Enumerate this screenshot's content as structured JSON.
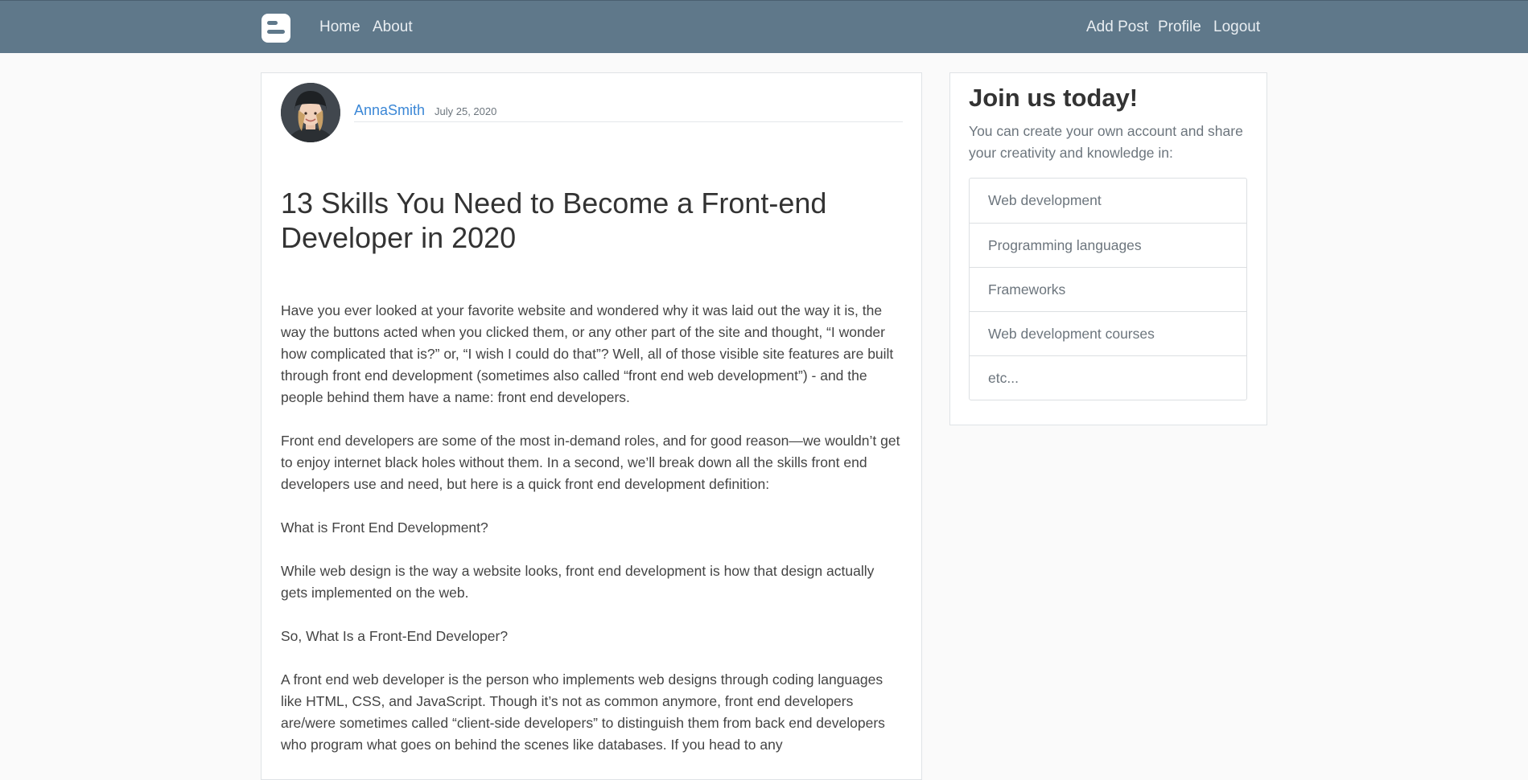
{
  "navbar": {
    "logo_icon": "blogger-logo-icon",
    "links_left": [
      {
        "label": "Home"
      },
      {
        "label": "About"
      }
    ],
    "links_right": [
      {
        "label": "Add Post"
      },
      {
        "label": "Profile"
      },
      {
        "label": "Logout"
      }
    ]
  },
  "post": {
    "author": "AnnaSmith",
    "date": "July 25, 2020",
    "avatar_icon": "author-avatar",
    "title": "13 Skills You Need to Become a Front-end Developer in 2020",
    "paragraphs": [
      "Have you ever looked at your favorite website and wondered why it was laid out the way it is, the way the buttons acted when you clicked them, or any other part of the site and thought, “I wonder how complicated that is?” or, “I wish I could do that”? Well, all of those visible site features are built through front end development (sometimes also called “front end web development”) - and the people behind them have a name: front end developers.",
      "Front end developers are some of the most in-demand roles, and for good reason—we wouldn’t get to enjoy internet black holes without them. In a second, we’ll break down all the skills front end developers use and need, but here is a quick front end development definition:",
      "What is Front End Development?",
      "While web design is the way a website looks, front end development is how that design actually gets implemented on the web.",
      "So, What Is a Front-End Developer?",
      "A front end web developer is the person who implements web designs through coding languages like HTML, CSS, and JavaScript. Though it’s not as common anymore, front end developers are/were sometimes called “client-side developers” to distinguish them from back end developers who program what goes on behind the scenes like databases. If you head to any"
    ]
  },
  "sidebar": {
    "title": "Join us today!",
    "text": "You can create your own account and share your creativity and knowledge in:",
    "items": [
      {
        "label": "Web development"
      },
      {
        "label": "Programming languages"
      },
      {
        "label": "Frameworks"
      },
      {
        "label": "Web development courses"
      },
      {
        "label": "etc..."
      }
    ]
  },
  "colors": {
    "navbar_bg": "#5f788a",
    "link": "#3b87d6",
    "page_bg": "#fafafa"
  }
}
